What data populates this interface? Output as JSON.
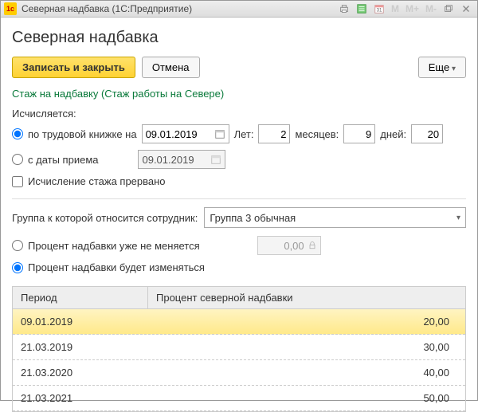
{
  "titlebar": {
    "app_icon_text": "1c",
    "title": "Северная надбавка  (1С:Предприятие)",
    "m_buttons": [
      "M",
      "M+",
      "M-"
    ]
  },
  "page": {
    "title": "Северная надбавка"
  },
  "toolbar": {
    "save_close": "Записать и закрыть",
    "cancel": "Отмена",
    "more": "Еще"
  },
  "link": {
    "stazh": "Стаж на надбавку (Стаж работы на Севере)"
  },
  "calc": {
    "label": "Исчисляется:",
    "by_book": "по трудовой книжке на",
    "by_book_date": "09.01.2019",
    "years_label": "Лет:",
    "years": "2",
    "months_label": "месяцев:",
    "months": "9",
    "days_label": "дней:",
    "days": "20",
    "from_hire": "с даты приема",
    "from_hire_date": "09.01.2019",
    "interrupted": "Исчисление стажа прервано"
  },
  "group": {
    "label": "Группа к которой относится сотрудник:",
    "value": "Группа 3 обычная"
  },
  "percent": {
    "fixed": "Процент надбавки уже не меняется",
    "fixed_value": "0,00",
    "changing": "Процент надбавки будет изменяться"
  },
  "table": {
    "col_period": "Период",
    "col_percent": "Процент северной надбавки",
    "rows": [
      {
        "period": "09.01.2019",
        "percent": "20,00",
        "selected": true
      },
      {
        "period": "21.03.2019",
        "percent": "30,00",
        "selected": false
      },
      {
        "period": "21.03.2020",
        "percent": "40,00",
        "selected": false
      },
      {
        "period": "21.03.2021",
        "percent": "50,00",
        "selected": false
      }
    ]
  }
}
